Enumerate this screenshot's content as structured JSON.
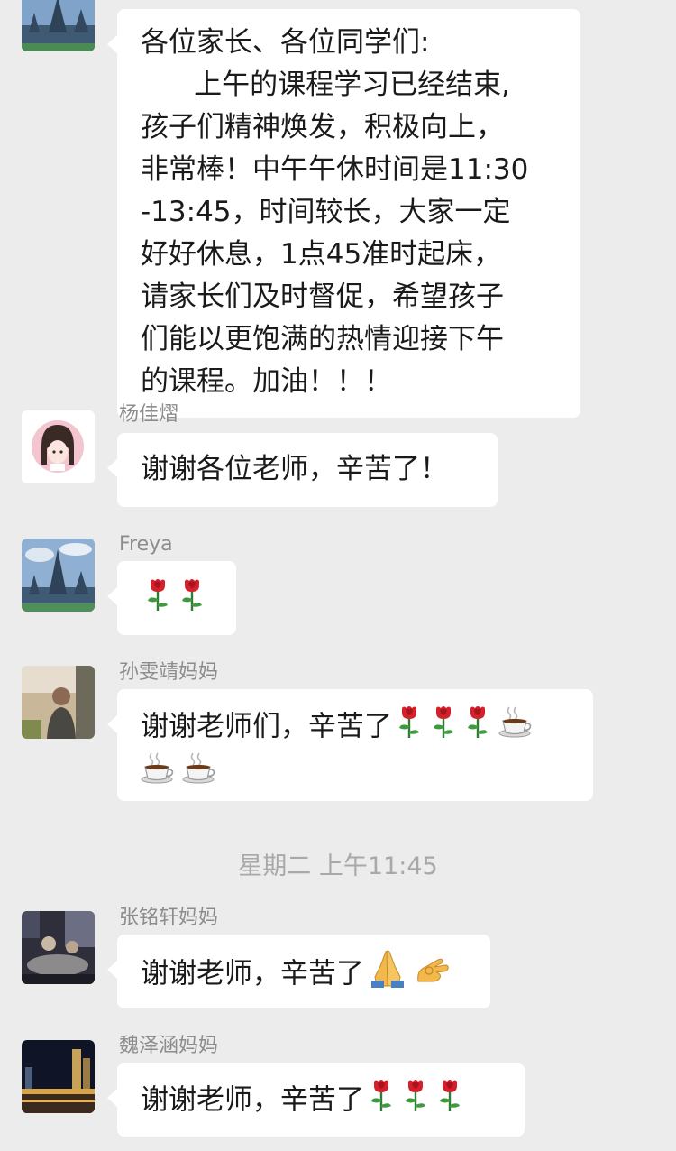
{
  "messages": [
    {
      "sender": "",
      "lines": [
        "各位家长、各位同学们:",
        "      上午的课程学习已经结束,",
        "孩子们精神焕发，积极向上，",
        "非常棒！中午午休时间是11:30",
        "-13:45，时间较长，大家一定",
        "好好休息，1点45准时起床，",
        "请家长们及时督促，希望孩子",
        "们能以更饱满的热情迎接下午",
        "的课程。加油！！！"
      ]
    },
    {
      "sender": "杨佳熠",
      "text": "谢谢各位老师，辛苦了！"
    },
    {
      "sender": "Freya",
      "emojis": [
        "rose-icon",
        "rose-icon"
      ]
    },
    {
      "sender": "孙雯靖妈妈",
      "text": "谢谢老师们，辛苦了",
      "emojis_line1": [
        "rose-icon",
        "rose-icon",
        "rose-icon",
        "coffee-icon"
      ],
      "emojis_line2": [
        "coffee-icon",
        "coffee-icon"
      ]
    },
    {
      "sender": "张铭轩妈妈",
      "text": "谢谢老师，辛苦了",
      "emojis": [
        "pray-hands-icon",
        "ok-hand-icon"
      ]
    },
    {
      "sender": "魏泽涵妈妈",
      "text": "谢谢老师，辛苦了",
      "emojis": [
        "rose-icon",
        "rose-icon",
        "rose-icon"
      ]
    }
  ],
  "timestamp": "星期二 上午11:45",
  "colors": {
    "background": "#ececec",
    "bubble": "#ffffff",
    "sender_name": "#8c8c8c",
    "timestamp": "#a8a8a8"
  }
}
